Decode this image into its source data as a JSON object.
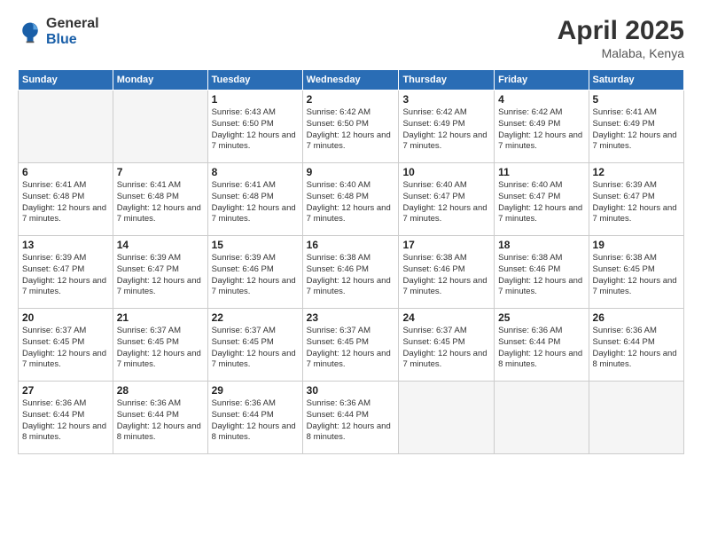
{
  "header": {
    "logo_general": "General",
    "logo_blue": "Blue",
    "month": "April 2025",
    "location": "Malaba, Kenya"
  },
  "days_of_week": [
    "Sunday",
    "Monday",
    "Tuesday",
    "Wednesday",
    "Thursday",
    "Friday",
    "Saturday"
  ],
  "weeks": [
    [
      {
        "day": "",
        "info": ""
      },
      {
        "day": "",
        "info": ""
      },
      {
        "day": "1",
        "info": "Sunrise: 6:43 AM\nSunset: 6:50 PM\nDaylight: 12 hours and 7 minutes."
      },
      {
        "day": "2",
        "info": "Sunrise: 6:42 AM\nSunset: 6:50 PM\nDaylight: 12 hours and 7 minutes."
      },
      {
        "day": "3",
        "info": "Sunrise: 6:42 AM\nSunset: 6:49 PM\nDaylight: 12 hours and 7 minutes."
      },
      {
        "day": "4",
        "info": "Sunrise: 6:42 AM\nSunset: 6:49 PM\nDaylight: 12 hours and 7 minutes."
      },
      {
        "day": "5",
        "info": "Sunrise: 6:41 AM\nSunset: 6:49 PM\nDaylight: 12 hours and 7 minutes."
      }
    ],
    [
      {
        "day": "6",
        "info": "Sunrise: 6:41 AM\nSunset: 6:48 PM\nDaylight: 12 hours and 7 minutes."
      },
      {
        "day": "7",
        "info": "Sunrise: 6:41 AM\nSunset: 6:48 PM\nDaylight: 12 hours and 7 minutes."
      },
      {
        "day": "8",
        "info": "Sunrise: 6:41 AM\nSunset: 6:48 PM\nDaylight: 12 hours and 7 minutes."
      },
      {
        "day": "9",
        "info": "Sunrise: 6:40 AM\nSunset: 6:48 PM\nDaylight: 12 hours and 7 minutes."
      },
      {
        "day": "10",
        "info": "Sunrise: 6:40 AM\nSunset: 6:47 PM\nDaylight: 12 hours and 7 minutes."
      },
      {
        "day": "11",
        "info": "Sunrise: 6:40 AM\nSunset: 6:47 PM\nDaylight: 12 hours and 7 minutes."
      },
      {
        "day": "12",
        "info": "Sunrise: 6:39 AM\nSunset: 6:47 PM\nDaylight: 12 hours and 7 minutes."
      }
    ],
    [
      {
        "day": "13",
        "info": "Sunrise: 6:39 AM\nSunset: 6:47 PM\nDaylight: 12 hours and 7 minutes."
      },
      {
        "day": "14",
        "info": "Sunrise: 6:39 AM\nSunset: 6:47 PM\nDaylight: 12 hours and 7 minutes."
      },
      {
        "day": "15",
        "info": "Sunrise: 6:39 AM\nSunset: 6:46 PM\nDaylight: 12 hours and 7 minutes."
      },
      {
        "day": "16",
        "info": "Sunrise: 6:38 AM\nSunset: 6:46 PM\nDaylight: 12 hours and 7 minutes."
      },
      {
        "day": "17",
        "info": "Sunrise: 6:38 AM\nSunset: 6:46 PM\nDaylight: 12 hours and 7 minutes."
      },
      {
        "day": "18",
        "info": "Sunrise: 6:38 AM\nSunset: 6:46 PM\nDaylight: 12 hours and 7 minutes."
      },
      {
        "day": "19",
        "info": "Sunrise: 6:38 AM\nSunset: 6:45 PM\nDaylight: 12 hours and 7 minutes."
      }
    ],
    [
      {
        "day": "20",
        "info": "Sunrise: 6:37 AM\nSunset: 6:45 PM\nDaylight: 12 hours and 7 minutes."
      },
      {
        "day": "21",
        "info": "Sunrise: 6:37 AM\nSunset: 6:45 PM\nDaylight: 12 hours and 7 minutes."
      },
      {
        "day": "22",
        "info": "Sunrise: 6:37 AM\nSunset: 6:45 PM\nDaylight: 12 hours and 7 minutes."
      },
      {
        "day": "23",
        "info": "Sunrise: 6:37 AM\nSunset: 6:45 PM\nDaylight: 12 hours and 7 minutes."
      },
      {
        "day": "24",
        "info": "Sunrise: 6:37 AM\nSunset: 6:45 PM\nDaylight: 12 hours and 7 minutes."
      },
      {
        "day": "25",
        "info": "Sunrise: 6:36 AM\nSunset: 6:44 PM\nDaylight: 12 hours and 8 minutes."
      },
      {
        "day": "26",
        "info": "Sunrise: 6:36 AM\nSunset: 6:44 PM\nDaylight: 12 hours and 8 minutes."
      }
    ],
    [
      {
        "day": "27",
        "info": "Sunrise: 6:36 AM\nSunset: 6:44 PM\nDaylight: 12 hours and 8 minutes."
      },
      {
        "day": "28",
        "info": "Sunrise: 6:36 AM\nSunset: 6:44 PM\nDaylight: 12 hours and 8 minutes."
      },
      {
        "day": "29",
        "info": "Sunrise: 6:36 AM\nSunset: 6:44 PM\nDaylight: 12 hours and 8 minutes."
      },
      {
        "day": "30",
        "info": "Sunrise: 6:36 AM\nSunset: 6:44 PM\nDaylight: 12 hours and 8 minutes."
      },
      {
        "day": "",
        "info": ""
      },
      {
        "day": "",
        "info": ""
      },
      {
        "day": "",
        "info": ""
      }
    ]
  ]
}
